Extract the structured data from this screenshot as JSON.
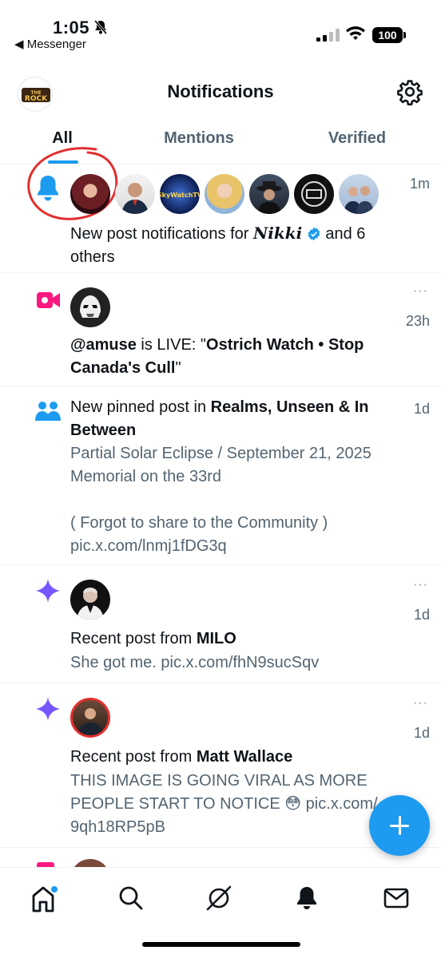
{
  "status_bar": {
    "time": "1:05",
    "back_app": "◀ Messenger",
    "battery": "100"
  },
  "header": {
    "title": "Notifications",
    "avatar_logo_text": "THE ROCK"
  },
  "tabs": [
    {
      "label": "All",
      "active": true
    },
    {
      "label": "Mentions",
      "active": false
    },
    {
      "label": "Verified",
      "active": false
    }
  ],
  "notifications": [
    {
      "type": "bell",
      "time": "1m",
      "text_prefix": "New post notifications for ",
      "name": "𝑵𝒊𝒌𝒌𝒊",
      "text_suffix": " and 6",
      "text_line2": "others",
      "avatar_labels": [
        "SkyWatchTV"
      ]
    },
    {
      "type": "live",
      "time": "23h",
      "more": "···",
      "handle": "@amuse",
      "text_mid": " is LIVE: \"",
      "title_bold": "Ostrich Watch • Stop",
      "title_bold2": "Canada's Cull",
      "text_end": "\""
    },
    {
      "type": "community",
      "time": "1d",
      "text_prefix": "New pinned post in ",
      "community_bold": "Realms, Unseen & In",
      "community_bold2": "Between",
      "sub_lines": [
        "Partial Solar Eclipse / September 21, 2025",
        "Memorial on the 33rd",
        "",
        "( Forgot to share to the Community )",
        "pic.x.com/lnmj1fDG3q"
      ]
    },
    {
      "type": "recommend",
      "time": "1d",
      "more": "···",
      "text_prefix": "Recent post from ",
      "name": "MILO",
      "sub": "She got me. pic.x.com/fhN9sucSqv"
    },
    {
      "type": "recommend",
      "time": "1d",
      "more": "···",
      "text_prefix": "Recent post from ",
      "name": "Matt Wallace",
      "sub_lines": [
        "THIS IMAGE IS GOING VIRAL AS MORE",
        "PEOPLE START TO NOTICE 😳 pic.x.com/",
        "9qh18RP5pB"
      ]
    }
  ],
  "colors": {
    "accent": "#1d9bf0",
    "live": "#f91880",
    "sparkle": "#7856ff",
    "annotation": "#e0302e"
  }
}
